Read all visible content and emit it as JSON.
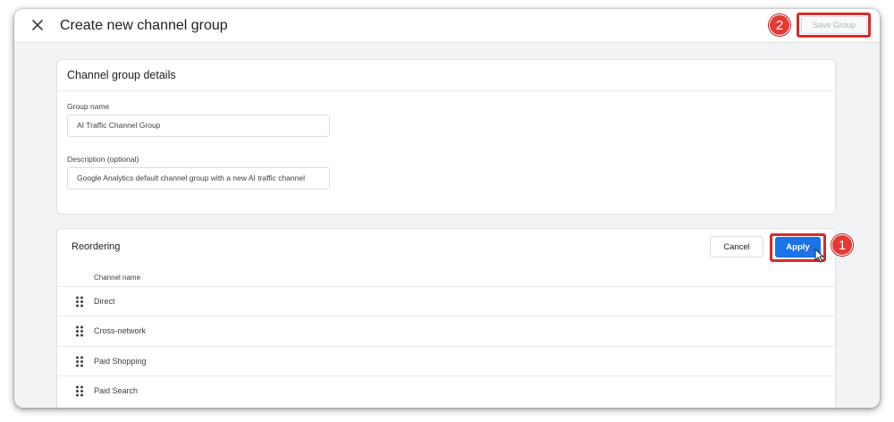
{
  "header": {
    "title": "Create new channel group",
    "save_label": "Save Group"
  },
  "details": {
    "title": "Channel group details",
    "group_name_label": "Group name",
    "group_name_value": "AI Traffic Channel Group",
    "description_label": "Description (optional)",
    "description_value": "Google Analytics default channel group with a new AI traffic channel"
  },
  "reordering": {
    "title": "Reordering",
    "cancel_label": "Cancel",
    "apply_label": "Apply",
    "column_header": "Channel name",
    "channels": [
      "Direct",
      "Cross-network",
      "Paid Shopping",
      "Paid Search"
    ]
  },
  "annotations": {
    "step_1": "1",
    "step_2": "2",
    "highlight_color": "#d62b2b"
  },
  "colors": {
    "primary": "#1a73e8",
    "background": "#f1f3f4"
  }
}
